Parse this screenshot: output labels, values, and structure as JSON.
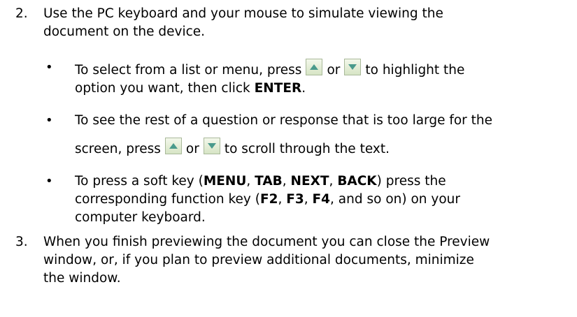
{
  "step2": {
    "number": "2.",
    "line1": "Use the PC keyboard and your mouse to simulate viewing the",
    "line2": "document on the device."
  },
  "bullets": {
    "b1": {
      "part1": "To select from a list or menu, press",
      "or": "or",
      "part2": "to highlight the",
      "part3": "option you want, then click",
      "enter": "ENTER",
      "period": "."
    },
    "b2": {
      "line1": "To see the rest of a question or response that is too large for the",
      "part1": "screen, press",
      "or": "or",
      "part2": "to scroll through the text."
    },
    "b3": {
      "l1a": "To press a soft key (",
      "menu": "MENU",
      "c1": ", ",
      "tab": "TAB",
      "c2": ", ",
      "next": "NEXT",
      "c3": ", ",
      "back": "BACK",
      "l1b": ") press the",
      "l2a": "corresponding function key (",
      "f2": "F2",
      "c4": ", ",
      "f3": "F3",
      "c5": ", ",
      "f4": "F4",
      "l2b": ", and so on) on your",
      "line3": "computer keyboard."
    },
    "bullet_char": "•"
  },
  "step3": {
    "number": "3.",
    "line1": "When you finish previewing the document you can close the Preview",
    "line2": "window, or, if you plan to preview additional documents, minimize",
    "line3": "the window."
  },
  "icons": {
    "up": "up-arrow-icon",
    "down": "down-arrow-icon",
    "button_fill": "#e8f0da",
    "arrow_color": "#4a9a8c"
  }
}
